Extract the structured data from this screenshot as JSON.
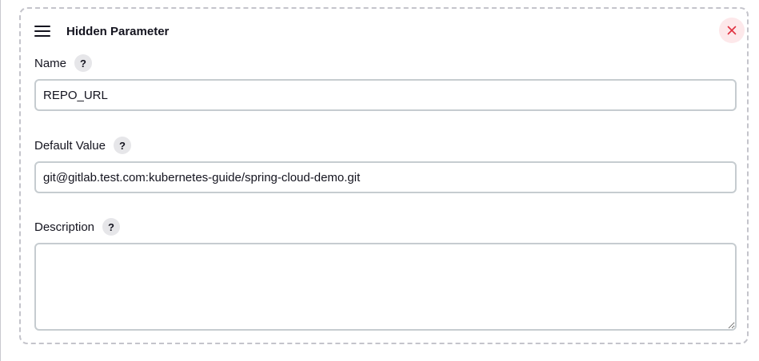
{
  "parameter": {
    "title": "Hidden Parameter",
    "drag_icon": "menu-drag-icon",
    "close_icon": "close-icon",
    "close_color": "#e0303f"
  },
  "fields": {
    "name": {
      "label": "Name",
      "help": "?",
      "value": "REPO_URL"
    },
    "default_value": {
      "label": "Default Value",
      "help": "?",
      "value": "git@gitlab.test.com:kubernetes-guide/spring-cloud-demo.git"
    },
    "description": {
      "label": "Description",
      "help": "?",
      "value": ""
    }
  }
}
